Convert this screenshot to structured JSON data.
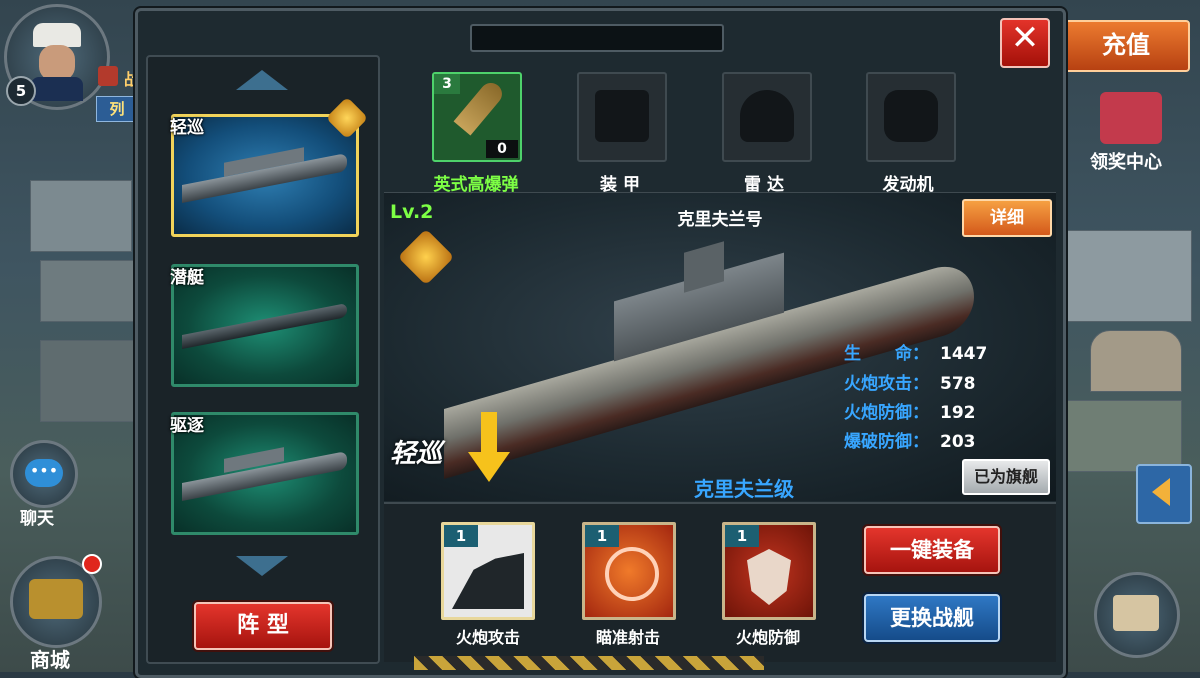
{
  "hud": {
    "player_level": "5",
    "battle_char": "战",
    "list_char": "列",
    "recharge_label": "充值",
    "reward_center_label": "领奖中心",
    "chat_label": "聊天",
    "shop_label": "商城"
  },
  "ship_list": [
    {
      "class_tag": "轻巡",
      "selected": true
    },
    {
      "class_tag": "潜艇",
      "selected": false
    },
    {
      "class_tag": "驱逐",
      "selected": false
    }
  ],
  "formation_button": "阵 型",
  "equipment": [
    {
      "label": "英式高爆弹",
      "count": "3",
      "quantity": "0",
      "equipped": true
    },
    {
      "label": "装 甲",
      "equipped": false
    },
    {
      "label": "雷 达",
      "equipped": false
    },
    {
      "label": "发动机",
      "equipped": false
    }
  ],
  "ship": {
    "level": "Lv.2",
    "name": "克里夫兰号",
    "class_name": "克里夫兰级",
    "type_tag": "轻巡",
    "detail_button": "详细",
    "flagship_button": "已为旗舰",
    "stats": [
      {
        "label": "生　　命：",
        "value": "1447"
      },
      {
        "label": "火炮攻击：",
        "value": "578"
      },
      {
        "label": "火炮防御：",
        "value": "192"
      },
      {
        "label": "爆破防御：",
        "value": "203"
      }
    ]
  },
  "skills": [
    {
      "label": "火炮攻击",
      "level": "1"
    },
    {
      "label": "瞄准射击",
      "level": "1"
    },
    {
      "label": "火炮防御",
      "level": "1"
    }
  ],
  "actions": {
    "one_click_equip": "一键装备",
    "change_ship": "更换战舰"
  },
  "colors": {
    "accent_blue": "#38a6ff",
    "highlight_green": "#7dff45",
    "selected_border": "#f1d35a"
  }
}
